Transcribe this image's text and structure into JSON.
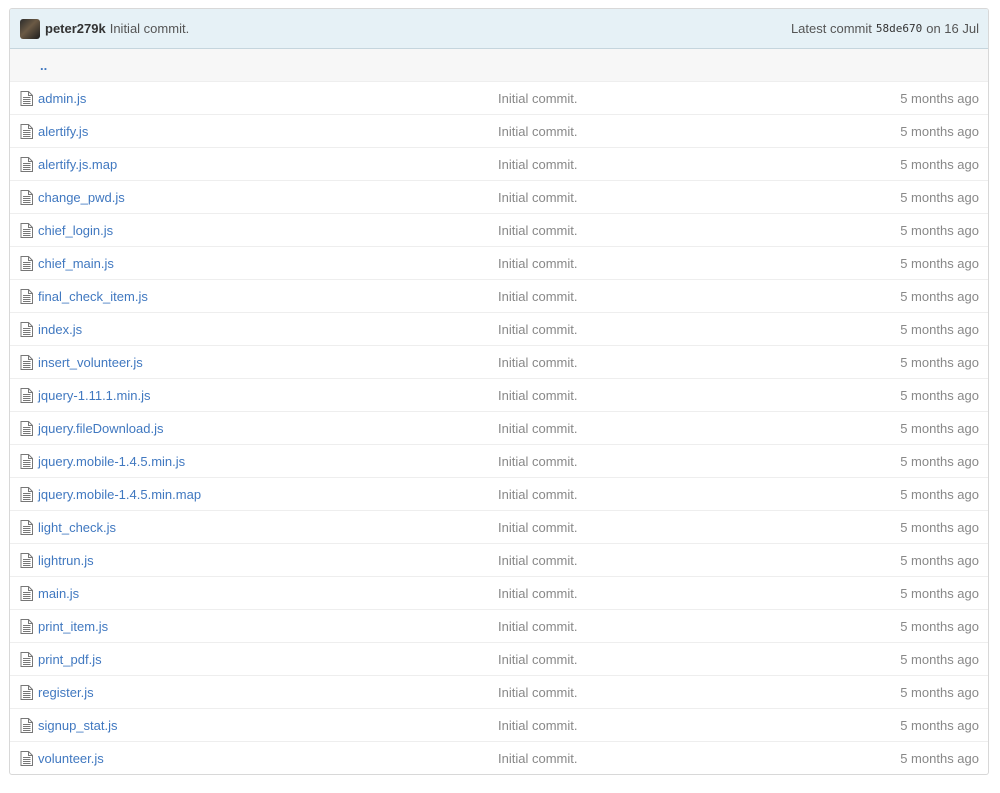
{
  "commit": {
    "author": "peter279k",
    "message": "Initial commit.",
    "latest_label": "Latest commit",
    "sha": "58de670",
    "date": "on 16 Jul"
  },
  "up_link": "..",
  "files": [
    {
      "name": "admin.js",
      "message": "Initial commit.",
      "age": "5 months ago"
    },
    {
      "name": "alertify.js",
      "message": "Initial commit.",
      "age": "5 months ago"
    },
    {
      "name": "alertify.js.map",
      "message": "Initial commit.",
      "age": "5 months ago"
    },
    {
      "name": "change_pwd.js",
      "message": "Initial commit.",
      "age": "5 months ago"
    },
    {
      "name": "chief_login.js",
      "message": "Initial commit.",
      "age": "5 months ago"
    },
    {
      "name": "chief_main.js",
      "message": "Initial commit.",
      "age": "5 months ago"
    },
    {
      "name": "final_check_item.js",
      "message": "Initial commit.",
      "age": "5 months ago"
    },
    {
      "name": "index.js",
      "message": "Initial commit.",
      "age": "5 months ago"
    },
    {
      "name": "insert_volunteer.js",
      "message": "Initial commit.",
      "age": "5 months ago"
    },
    {
      "name": "jquery-1.11.1.min.js",
      "message": "Initial commit.",
      "age": "5 months ago"
    },
    {
      "name": "jquery.fileDownload.js",
      "message": "Initial commit.",
      "age": "5 months ago"
    },
    {
      "name": "jquery.mobile-1.4.5.min.js",
      "message": "Initial commit.",
      "age": "5 months ago"
    },
    {
      "name": "jquery.mobile-1.4.5.min.map",
      "message": "Initial commit.",
      "age": "5 months ago"
    },
    {
      "name": "light_check.js",
      "message": "Initial commit.",
      "age": "5 months ago"
    },
    {
      "name": "lightrun.js",
      "message": "Initial commit.",
      "age": "5 months ago"
    },
    {
      "name": "main.js",
      "message": "Initial commit.",
      "age": "5 months ago"
    },
    {
      "name": "print_item.js",
      "message": "Initial commit.",
      "age": "5 months ago"
    },
    {
      "name": "print_pdf.js",
      "message": "Initial commit.",
      "age": "5 months ago"
    },
    {
      "name": "register.js",
      "message": "Initial commit.",
      "age": "5 months ago"
    },
    {
      "name": "signup_stat.js",
      "message": "Initial commit.",
      "age": "5 months ago"
    },
    {
      "name": "volunteer.js",
      "message": "Initial commit.",
      "age": "5 months ago"
    }
  ],
  "icons": {
    "avatar": "avatar",
    "file": "file-text-icon"
  },
  "colors": {
    "link": "#4078c0",
    "commit_bar": "#e6f1f6",
    "muted": "#888888"
  }
}
